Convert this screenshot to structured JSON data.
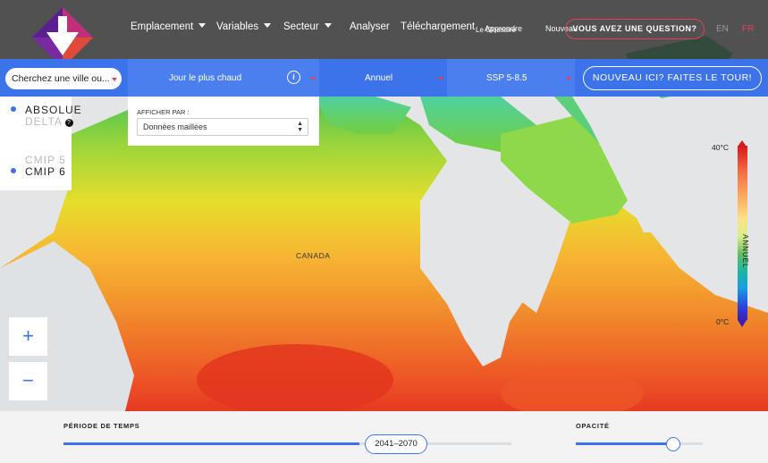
{
  "nav": {
    "items": [
      {
        "label": "Emplacement",
        "dropdown": true
      },
      {
        "label": "Variables",
        "dropdown": true
      },
      {
        "label": "Secteur",
        "dropdown": true
      },
      {
        "label": "Analyser",
        "dropdown": false
      },
      {
        "label": "Téléchargement",
        "dropdown": false
      }
    ],
    "extra_links": [
      "Apprendre",
      "Le Glossaire",
      "Nouveau"
    ],
    "question_button": "VOUS AVEZ UNE QUESTION?",
    "languages": [
      "EN",
      "FR"
    ],
    "active_language": "FR"
  },
  "filters": {
    "city_placeholder": "Cherchez une ville ou...",
    "variable": "Jour le plus chaud",
    "info_symbol": "i",
    "frequency": "Annuel",
    "scenario": "SSP 5-8.5",
    "tour_button": "NOUVEAU ICI? FAITES LE TOUR!",
    "display_by_label": "AFFICHER PAR :",
    "display_by_value": "Données maillées"
  },
  "mode": {
    "options": [
      {
        "label": "ABSOLUE",
        "selected": true
      },
      {
        "label": "DELTA",
        "selected": false,
        "help": "?"
      }
    ]
  },
  "dataset": {
    "options": [
      {
        "label": "CMIP 5",
        "selected": false
      },
      {
        "label": "CMIP 6",
        "selected": true
      }
    ]
  },
  "zoom": {
    "in": "+",
    "out": "−"
  },
  "map": {
    "region_label": "CANADA"
  },
  "legend": {
    "max": "40°C",
    "min": "0°C",
    "title": "ANNUEL"
  },
  "time": {
    "label": "PÉRIODE DE TEMPS",
    "period": "2041–2070",
    "position_fraction": 0.66
  },
  "opacity": {
    "label": "OPACITÉ",
    "value_fraction": 0.77
  },
  "colors": {
    "accent": "#3d73ea",
    "brand_red": "#e0405a",
    "brand_purple": "#7a2aa0"
  }
}
